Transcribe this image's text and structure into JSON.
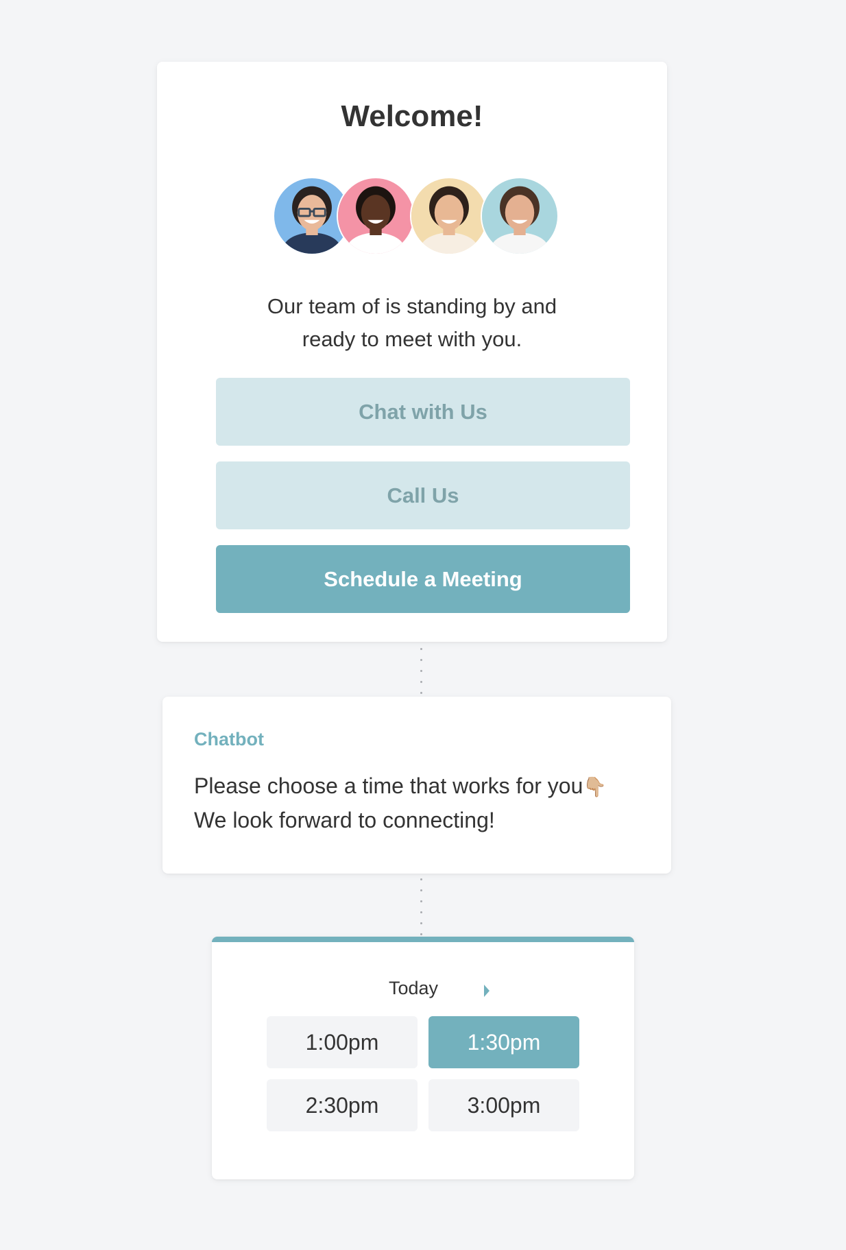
{
  "welcome": {
    "title": "Welcome!",
    "intro_line1": "Our team of is standing by and",
    "intro_line2": "ready to meet with you.",
    "avatars": [
      {
        "name": "team-member-1",
        "bg": "#7fb8ea",
        "skin": "#e9b99a",
        "hair": "#2a2220",
        "shirt": "#283a5a",
        "glasses": true
      },
      {
        "name": "team-member-2",
        "bg": "#f493a6",
        "skin": "#5a3523",
        "hair": "#1c1410",
        "shirt": "#ffffff",
        "glasses": false
      },
      {
        "name": "team-member-3",
        "bg": "#f3dcae",
        "skin": "#e8b894",
        "hair": "#2e211b",
        "shirt": "#f7eee2",
        "glasses": false
      },
      {
        "name": "team-member-4",
        "bg": "#a9d6de",
        "skin": "#e4b091",
        "hair": "#4a3326",
        "shirt": "#f6f6f6",
        "glasses": false
      }
    ],
    "buttons": {
      "chat": "Chat with Us",
      "call": "Call Us",
      "schedule": "Schedule a Meeting"
    }
  },
  "chatbot": {
    "label": "Chatbot",
    "line1": "Please choose a time that works for you",
    "emoji": "👇🏼",
    "line2": "We look forward to connecting!"
  },
  "scheduler": {
    "day": "Today",
    "slots": [
      {
        "time": "1:00pm",
        "selected": false
      },
      {
        "time": "1:30pm",
        "selected": true
      },
      {
        "time": "2:30pm",
        "selected": false
      },
      {
        "time": "3:00pm",
        "selected": false
      }
    ]
  },
  "colors": {
    "accent": "#73b1bd",
    "accent_light": "#d4e7eb",
    "accent_light_text": "#7fa3a9",
    "page_bg": "#f4f5f7",
    "slot_bg": "#f3f4f6",
    "text": "#333333"
  }
}
